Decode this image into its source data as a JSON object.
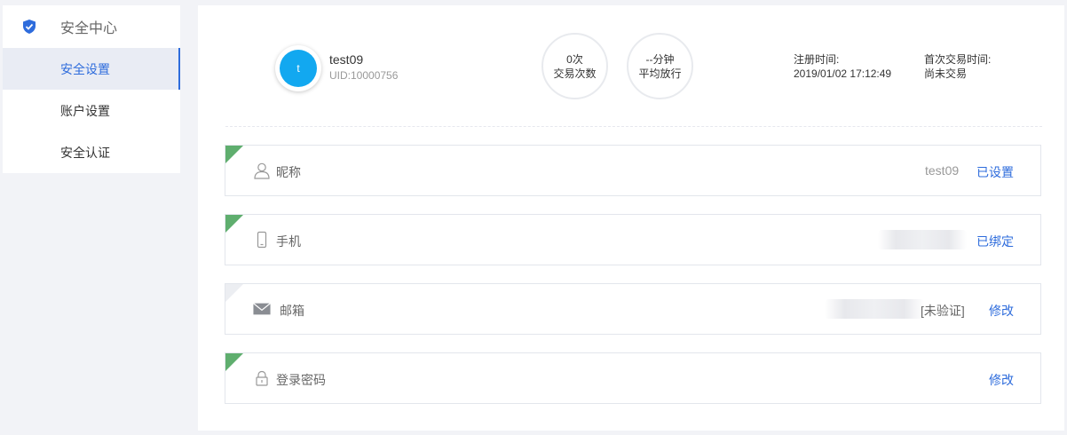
{
  "sidebar": {
    "title": "安全中心",
    "items": [
      {
        "label": "安全设置"
      },
      {
        "label": "账户设置"
      },
      {
        "label": "安全认证"
      }
    ]
  },
  "profile": {
    "avatar_letter": "t",
    "username": "test09",
    "uid": "UID:10000756",
    "stats": [
      {
        "value": "0次",
        "label": "交易次数"
      },
      {
        "value": "--分钟",
        "label": "平均放行"
      }
    ],
    "register": {
      "label": "注册时间:",
      "value": "2019/01/02 17:12:49"
    },
    "first_trade": {
      "label": "首次交易时间:",
      "value": "尚未交易"
    }
  },
  "rows": {
    "nickname": {
      "label": "昵称",
      "value": "test09",
      "action": "已设置",
      "icon": "user-icon"
    },
    "phone": {
      "label": "手机",
      "action": "已绑定",
      "icon": "phone-icon"
    },
    "email": {
      "label": "邮箱",
      "status": "[未验证]",
      "action": "修改",
      "icon": "mail-icon"
    },
    "password": {
      "label": "登录密码",
      "action": "修改",
      "icon": "lock-icon"
    }
  },
  "colors": {
    "accent": "#2e6cdc",
    "avatar": "#12a8f0",
    "corner_set": "#5fae6e"
  }
}
